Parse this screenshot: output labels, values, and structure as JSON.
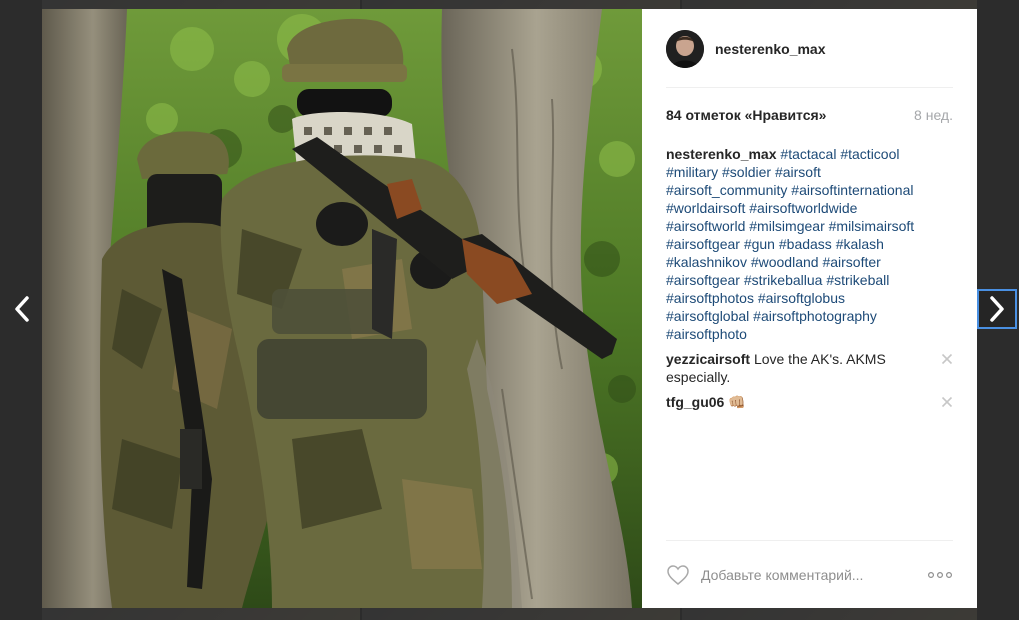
{
  "post": {
    "username": "nesterenko_max",
    "likes": "84 отметок «Нравится»",
    "time": "8 нед."
  },
  "comments": [
    {
      "user": "nesterenko_max",
      "tags": [
        "#tactacal",
        "#tacticool",
        "#military",
        "#soldier",
        "#airsoft",
        "#airsoft_community",
        "#airsoftinternational",
        "#worldairsoft",
        "#airsoftworldwide",
        "#airsoftworld",
        "#milsimgear",
        "#milsimairsoft",
        "#airsoftgear",
        "#gun",
        "#badass",
        "#kalash",
        "#kalashnikov",
        "#woodland",
        "#airsofter",
        "#airsoftgear",
        "#strikeballua",
        "#strikeball",
        "#airsoftphotos",
        "#airsoftglobus",
        "#airsoftglobal",
        "#airsoftphotography",
        "#airsoftphoto"
      ]
    },
    {
      "user": "yezzicairsoft",
      "text": "Love the AK's. AKMS especially."
    },
    {
      "user": "tfg_gu06",
      "text": "👊🏼"
    }
  ],
  "comment_box": {
    "placeholder": "Добавьте комментарий..."
  },
  "icons": {
    "prev": "chevron-left-icon",
    "next": "chevron-right-icon",
    "like": "heart-icon",
    "delete": "close-icon",
    "more": "more-options-icon"
  },
  "colors": {
    "hashtag": "#1d4a77",
    "username": "#262626",
    "muted": "#a5a7aa",
    "focus_ring": "#4a90e2"
  }
}
